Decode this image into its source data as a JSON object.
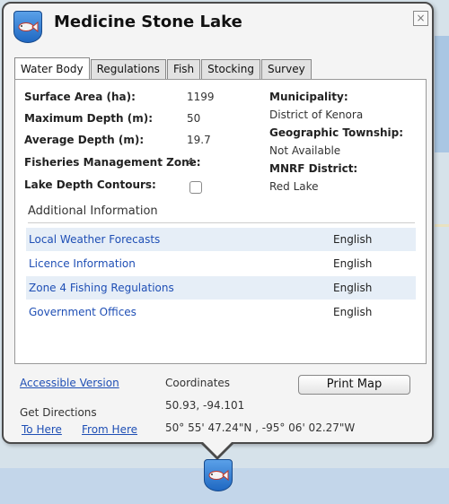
{
  "popup": {
    "title": "Medicine Stone Lake",
    "close_symbol": "×"
  },
  "tabs": [
    {
      "label": "Water Body",
      "active": true
    },
    {
      "label": "Regulations",
      "active": false
    },
    {
      "label": "Fish",
      "active": false
    },
    {
      "label": "Stocking",
      "active": false
    },
    {
      "label": "Survey",
      "active": false
    }
  ],
  "water_body": {
    "surface_area_label": "Surface Area (ha):",
    "surface_area_value": "1199",
    "max_depth_label": "Maximum Depth (m):",
    "max_depth_value": "50",
    "avg_depth_label": "Average Depth (m):",
    "avg_depth_value": "19.7",
    "fmz_label": "Fisheries Management Zone:",
    "fmz_value": "4",
    "contours_label": "Lake Depth Contours:",
    "contours_checked": false,
    "municipality_label": "Municipality:",
    "municipality_value": "District of Kenora",
    "township_label": "Geographic Township:",
    "township_value": "Not Available",
    "mnrf_label": "MNRF District:",
    "mnrf_value": "Red Lake"
  },
  "additional": {
    "heading": "Additional Information",
    "rows": [
      {
        "link": "Local Weather Forecasts",
        "language": "English"
      },
      {
        "link": "Licence Information",
        "language": "English"
      },
      {
        "link": "Zone 4 Fishing Regulations",
        "language": "English"
      },
      {
        "link": "Government Offices",
        "language": "English"
      }
    ]
  },
  "footer": {
    "accessible_version": "Accessible Version",
    "get_directions": "Get Directions",
    "to_here": "To Here",
    "from_here": "From Here",
    "coordinates_label": "Coordinates",
    "coordinates_decimal": "50.93, -94.101",
    "coordinates_dms": "50° 55' 47.24\"N , -95° 06' 02.27\"W",
    "print_map": "Print Map"
  },
  "colors": {
    "link": "#1f4fb5",
    "marker": "#2f7fd8",
    "row_shade": "#e6eef7"
  },
  "icons": [
    "fish-marker-icon",
    "close-icon",
    "checkbox"
  ]
}
